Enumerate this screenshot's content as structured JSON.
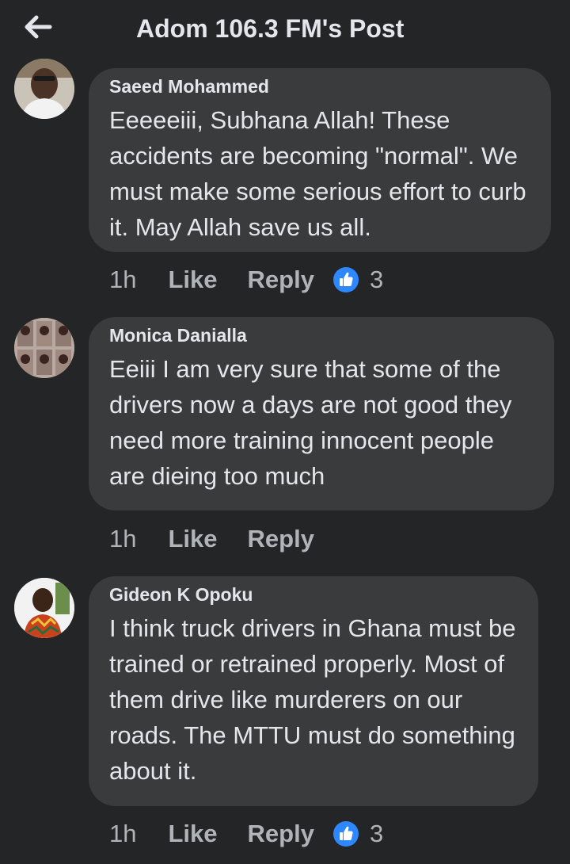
{
  "header": {
    "title": "Adom 106.3 FM's Post",
    "back_icon": "arrow-left-icon"
  },
  "comments": [
    {
      "author": "Saeed Mohammed",
      "text": "Eeeeeiii, Subhana Allah! These accidents are becoming \"normal\". We must make some serious effort to curb it. May Allah save us all.",
      "time": "1h",
      "like_label": "Like",
      "reply_label": "Reply",
      "reaction_count": "3",
      "reaction_icon": "thumbs-up-icon"
    },
    {
      "author": "Monica Danialla",
      "text": "Eeiii I am very sure that some of the drivers now a days are not good they need more training innocent people are dieing too much",
      "time": "1h",
      "like_label": "Like",
      "reply_label": "Reply"
    },
    {
      "author": "Gideon K Opoku",
      "text": "I think truck drivers in Ghana must be trained or retrained properly. Most of them drive like murderers on our roads. The MTTU must do something about it.",
      "time": "1h",
      "like_label": "Like",
      "reply_label": "Reply",
      "reaction_count": "3",
      "reaction_icon": "thumbs-up-icon"
    }
  ],
  "colors": {
    "background": "#242526",
    "bubble": "#3a3b3c",
    "text": "#e4e6eb",
    "secondary_text": "#b0b3b8",
    "like_blue": "#2d88ff"
  }
}
